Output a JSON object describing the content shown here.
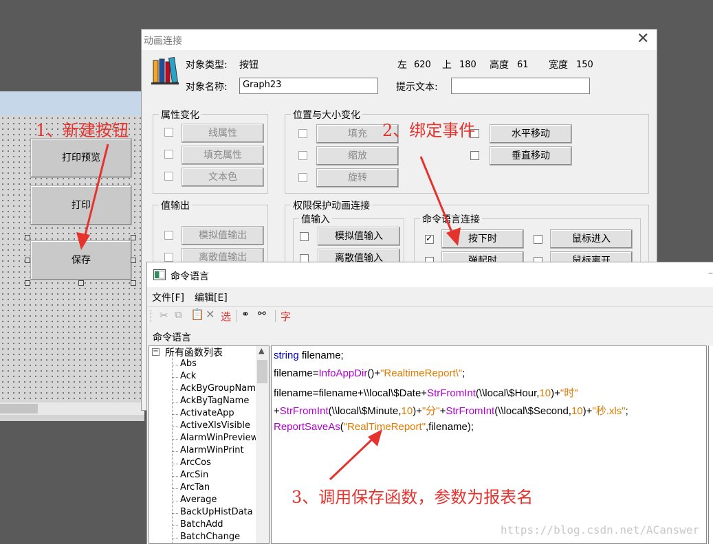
{
  "canvas": {
    "buttons": [
      {
        "label": "打印预览"
      },
      {
        "label": "打印"
      },
      {
        "label": "保存"
      }
    ]
  },
  "anim_dialog": {
    "title": "动画连接",
    "object_type_label": "对象类型:",
    "object_type_value": "按钮",
    "left_label": "左",
    "left_value": "620",
    "top_label": "上",
    "top_value": "180",
    "height_label": "高度",
    "height_value": "61",
    "width_label": "宽度",
    "width_value": "150",
    "object_name_label": "对象名称:",
    "object_name_value": "Graph23",
    "tooltip_label": "提示文本:",
    "tooltip_value": "",
    "attr_group": {
      "title": "属性变化",
      "items": [
        "线属性",
        "填充属性",
        "文本色"
      ]
    },
    "pos_group": {
      "title": "位置与大小变化",
      "items": [
        "填充",
        "缩放",
        "旋转"
      ],
      "right_items": [
        "水平移动",
        "垂直移动"
      ]
    },
    "value_out_group": {
      "title": "值输出",
      "items": [
        "模拟值输出",
        "离散值输出"
      ]
    },
    "perm_group": {
      "title": "权限保护动画连接"
    },
    "value_in_group": {
      "title": "值输入",
      "items": [
        "模拟值输入",
        "离散值输入"
      ]
    },
    "cmd_group": {
      "title": "命令语言连接",
      "items": [
        "按下时",
        "弹起时"
      ],
      "right_items": [
        "鼠标进入",
        "鼠标离开"
      ]
    }
  },
  "cmd_window": {
    "title": "命令语言",
    "menu": [
      "文件[F]",
      "编辑[E]"
    ],
    "toolbar": {
      "select_label": "选",
      "font_label": "字"
    },
    "panel_label": "命令语言",
    "tree_root": "所有函数列表",
    "functions": [
      "Abs",
      "Ack",
      "AckByGroupName",
      "AckByTagName",
      "ActivateApp",
      "ActiveXlsVisible",
      "AlarmWinPreview",
      "AlarmWinPrint",
      "ArcCos",
      "ArcSin",
      "ArcTan",
      "Average",
      "BackUpHistData",
      "BatchAdd",
      "BatchChange"
    ],
    "code": {
      "l1_kw": "string",
      "l1_rest": " filename;",
      "l2_a": "filename=",
      "l2_fn": "InfoAppDir",
      "l2_b": "()+",
      "l2_str": "\"RealtimeReport\\\"",
      "l2_c": ";",
      "l3_a": "filename=filename+\\\\local\\$Date+",
      "l3_fn": "StrFromInt",
      "l3_b": "(\\\\local\\$Hour,",
      "l3_num": "10",
      "l3_c": ")+",
      "l3_str": "\"时\"",
      "l4_a": "+",
      "l4_fn1": "StrFromInt",
      "l4_b": "(\\\\local\\$Minute,",
      "l4_num1": "10",
      "l4_c": ")+",
      "l4_str1": "\"分\"",
      "l4_d": "+",
      "l4_fn2": "StrFromInt",
      "l4_e": "(\\\\local\\$Second,",
      "l4_num2": "10",
      "l4_f": ")+",
      "l4_str2": "\"秒.xls\"",
      "l4_g": ";",
      "l5_fn": "ReportSaveAs",
      "l5_a": "(",
      "l5_str": "\"RealTimeReport\"",
      "l5_b": ",filename);"
    }
  },
  "annotations": {
    "step1": "1、新建按钮",
    "step2": "2、绑定事件",
    "step3": "3、调用保存函数，参数为报表名"
  },
  "watermark": "https://blog.csdn.net/ACanswer",
  "colors": {
    "annotation": "#e5322d",
    "keyword": "#0000cc",
    "function": "#b000d0",
    "string": "#e07a00"
  }
}
